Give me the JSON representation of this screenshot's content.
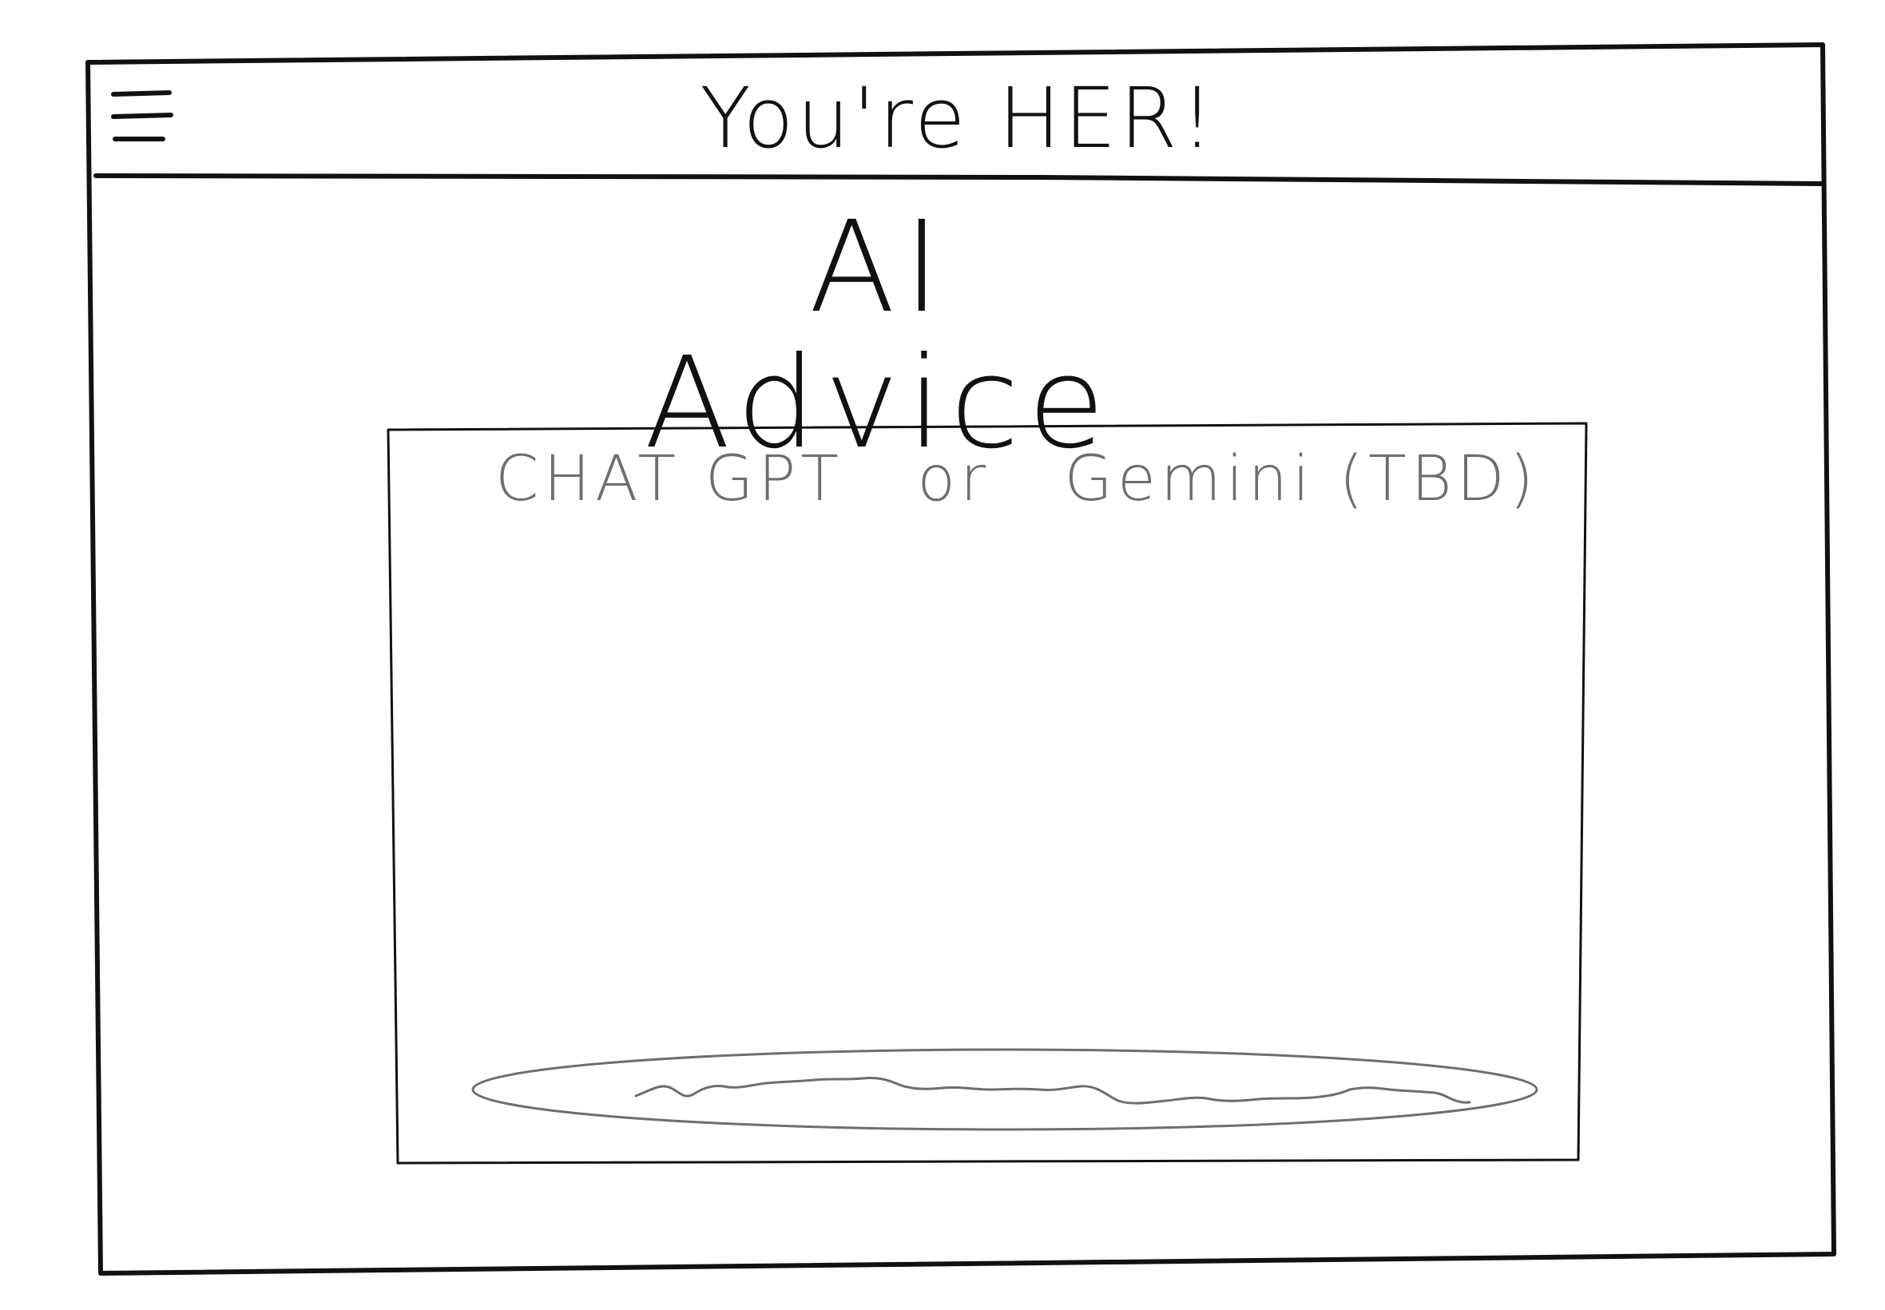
{
  "header": {
    "title": "You're HER!",
    "menu_icon": "hamburger-menu-icon"
  },
  "main": {
    "heading": "AI Advice",
    "chat_panel": {
      "provider_text": "CHAT GPT   or   Gemini (TBD)"
    }
  },
  "colors": {
    "ink": "#111111",
    "pencil": "#6e6e6e",
    "background": "#ffffff"
  }
}
